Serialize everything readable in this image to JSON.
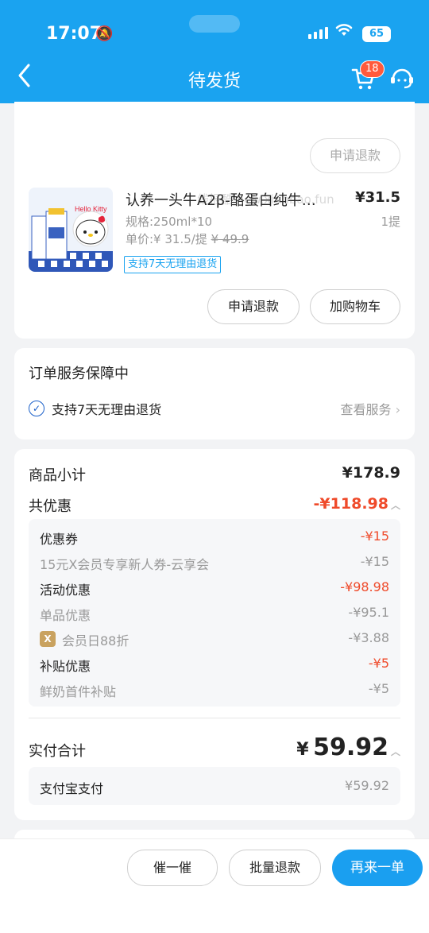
{
  "status_bar": {
    "time": "17:07",
    "battery": "65"
  },
  "nav": {
    "title": "待发货",
    "cart_count": "18"
  },
  "product_card": {
    "refund_top_label": "申请退款",
    "product": {
      "name": "认养一头牛A2β-酪蛋白纯牛…",
      "price": "¥31.5",
      "spec": "规格:250ml*10",
      "qty": "1提",
      "unit_price_label": "单价:¥",
      "unit_price": " 31.5/提 ",
      "original_price": "¥ 49.9",
      "tag": "支持7天无理由退货"
    },
    "refund_label": "申请退款",
    "add_cart_label": "加购物车",
    "watermark": "线报酷 new.xianbao.fun"
  },
  "service_card": {
    "title": "订单服务保障中",
    "item": "支持7天无理由退货",
    "link": "查看服务"
  },
  "price_card": {
    "subtotal_label": "商品小计",
    "subtotal_value": "¥178.9",
    "discount_label": "共优惠",
    "discount_value": "-¥118.98",
    "details": {
      "coupon_label": "优惠券",
      "coupon_value": "-¥15",
      "coupon_item_label": "15元X会员专享新人券-云享会",
      "coupon_item_value": "-¥15",
      "activity_label": "活动优惠",
      "activity_value": "-¥98.98",
      "single_label": "单品优惠",
      "single_value": "-¥95.1",
      "member_label": "会员日88折",
      "member_value": "-¥3.88",
      "subsidy_label": "补贴优惠",
      "subsidy_value": "-¥5",
      "milk_label": "鲜奶首件补贴",
      "milk_value": "-¥5"
    },
    "paid_label": "实付合计",
    "paid_currency": "¥",
    "paid_value": "59.92",
    "alipay_label": "支付宝支付",
    "alipay_value": "¥59.92"
  },
  "bottom_bar": {
    "remind_label": "催一催",
    "batch_refund_label": "批量退款",
    "reorder_label": "再来一单"
  },
  "colors": {
    "brand": "#1aa3f0",
    "accent_red": "#ef4a2a",
    "primary_button": "#1a9ff0"
  }
}
